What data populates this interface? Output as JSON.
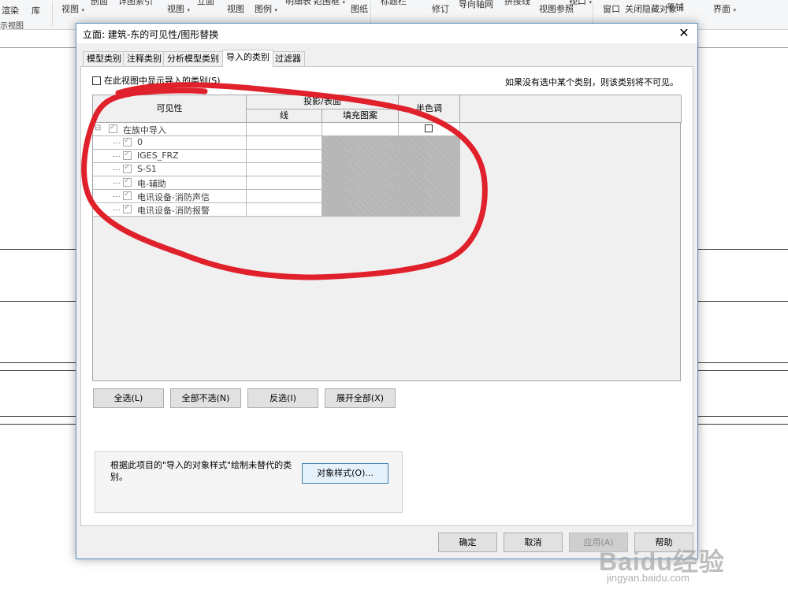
{
  "ribbon": {
    "items": [
      "渲染",
      "库",
      "视图",
      "剖面",
      "详图索引",
      "视图",
      "立面",
      "视图",
      "图例",
      "明细表",
      "范围框",
      "图纸",
      "标题栏",
      "修订",
      "导向轴网",
      "拼接线",
      "视图参照",
      "视口",
      "窗口",
      "关闭隐藏对象",
      "平铺",
      "界面"
    ],
    "group_label": "示视图"
  },
  "dialog": {
    "title": "立面: 建筑-东的可见性/图形替换",
    "close_symbol": "✕",
    "tabs": [
      "模型类别",
      "注释类别",
      "分析模型类别",
      "导入的类别",
      "过滤器"
    ],
    "active_tab": "导入的类别",
    "show_imported_label": "在此视图中显示导入的类别(S)",
    "notice": "如果没有选中某个类别，则该类别将不可见。",
    "grid": {
      "col_visibility": "可见性",
      "col_projection": "投影/表面",
      "col_line": "线",
      "col_fill": "填充图案",
      "col_halftone": "半色调",
      "rows": [
        {
          "label": "在族中导入",
          "level": 0,
          "expand": "⊟"
        },
        {
          "label": "0",
          "level": 1
        },
        {
          "label": "IGES_FRZ",
          "level": 1
        },
        {
          "label": "S-S1",
          "level": 1
        },
        {
          "label": "电-辅助",
          "level": 1
        },
        {
          "label": "电讯设备-消防声信",
          "level": 1
        },
        {
          "label": "电讯设备-消防报警",
          "level": 1
        }
      ]
    },
    "buttons": {
      "select_all": "全选(L)",
      "select_none": "全部不选(N)",
      "invert": "反选(I)",
      "expand_all": "展开全部(X)",
      "object_styles": "对象样式(O)...",
      "ok": "确定",
      "cancel": "取消",
      "apply": "应用(A)",
      "help": "帮助"
    },
    "note": "根据此项目的\"导入的对象样式\"绘制未替代的类别。"
  },
  "annotation_color": "#e0202a",
  "watermark": {
    "brand": "Baidu经验",
    "sub": "jingyan.baidu.com"
  }
}
